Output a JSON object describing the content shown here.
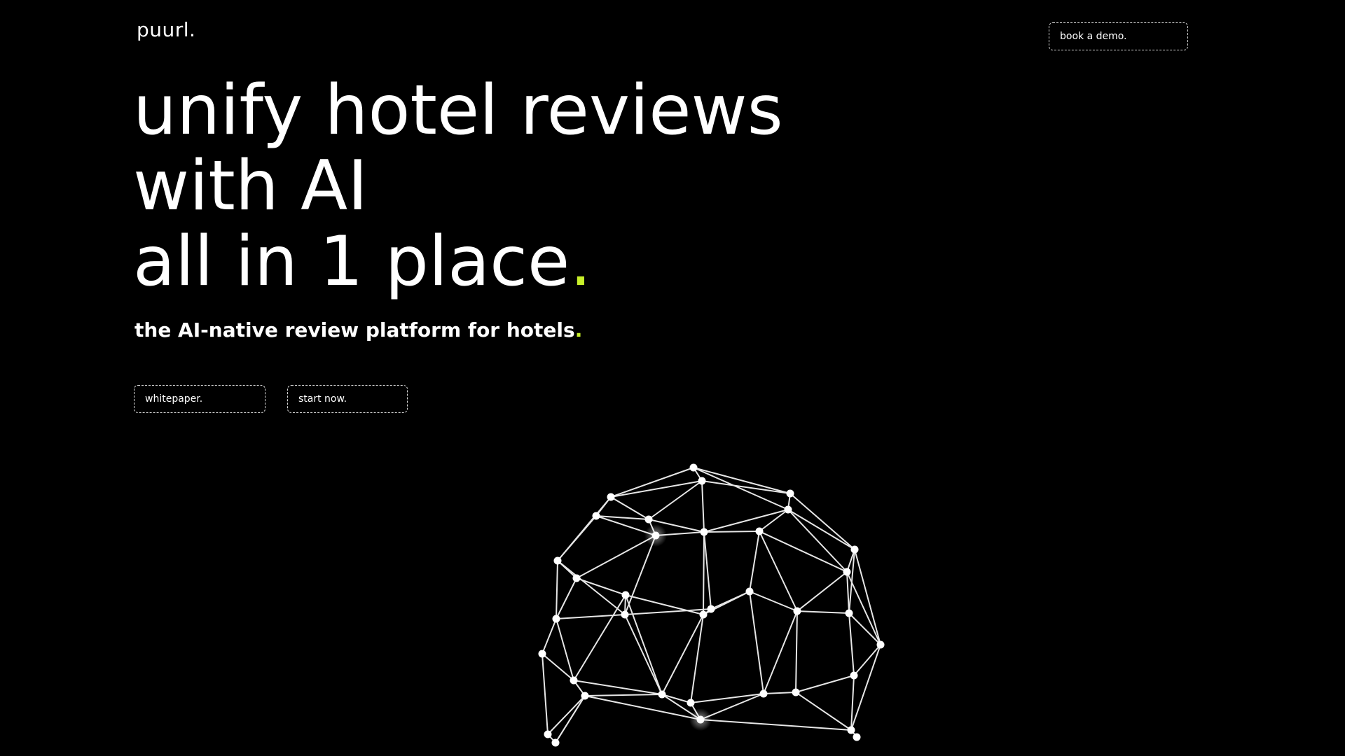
{
  "header": {
    "logo": "puurl.",
    "demo_label": "book a demo."
  },
  "hero": {
    "line1": "unify hotel reviews",
    "line2": "with AI",
    "line3": "all in 1 place",
    "line3_dot": ".",
    "subtitle": "the AI-native review platform for hotels",
    "subtitle_dot": "."
  },
  "cta": {
    "whitepaper_label": "whitepaper.",
    "start_label": "start now."
  },
  "colors": {
    "background": "#000000",
    "text": "#ffffff",
    "accent": "#c8f02a"
  },
  "graphic": {
    "icon": "geodesic-sphere-icon"
  }
}
